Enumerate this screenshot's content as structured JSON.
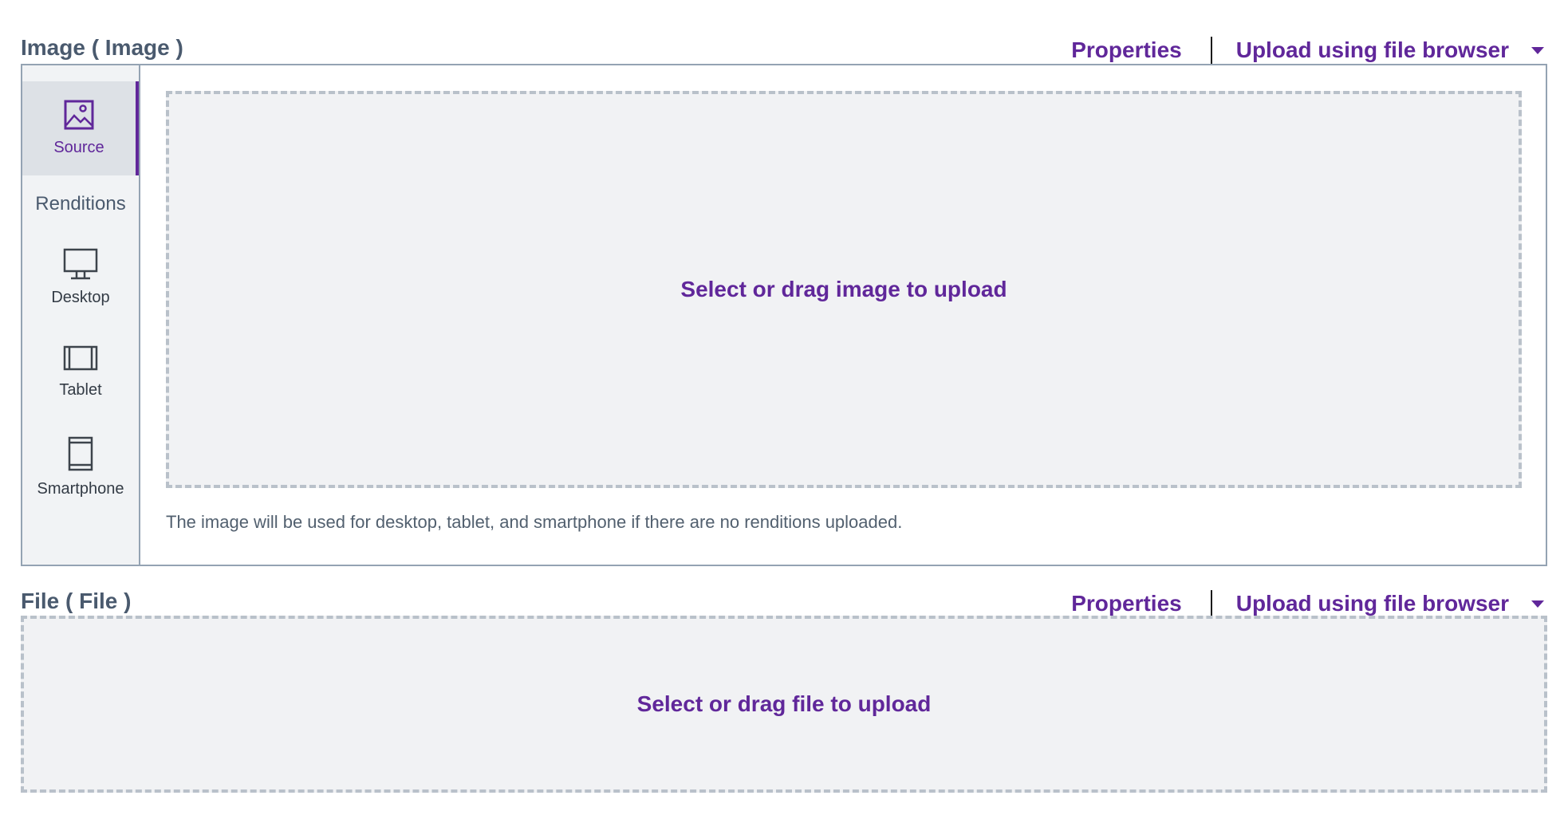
{
  "image_section": {
    "title": "Image ( Image )",
    "properties_label": "Properties",
    "upload_label": "Upload using file browser",
    "sidebar": {
      "source_label": "Source",
      "renditions_label": "Renditions",
      "desktop_label": "Desktop",
      "tablet_label": "Tablet",
      "smartphone_label": "Smartphone"
    },
    "dropzone_text": "Select or drag image to upload",
    "hint": "The image will be used for desktop, tablet, and smartphone if there are no renditions uploaded."
  },
  "file_section": {
    "title": "File ( File )",
    "properties_label": "Properties",
    "upload_label": "Upload using file browser",
    "dropzone_text": "Select or drag file to upload"
  },
  "colors": {
    "accent": "#60279a",
    "border": "#94a3b3",
    "dropzone_bg": "#f1f2f4",
    "sidebar_bg": "#f1f3f5"
  }
}
